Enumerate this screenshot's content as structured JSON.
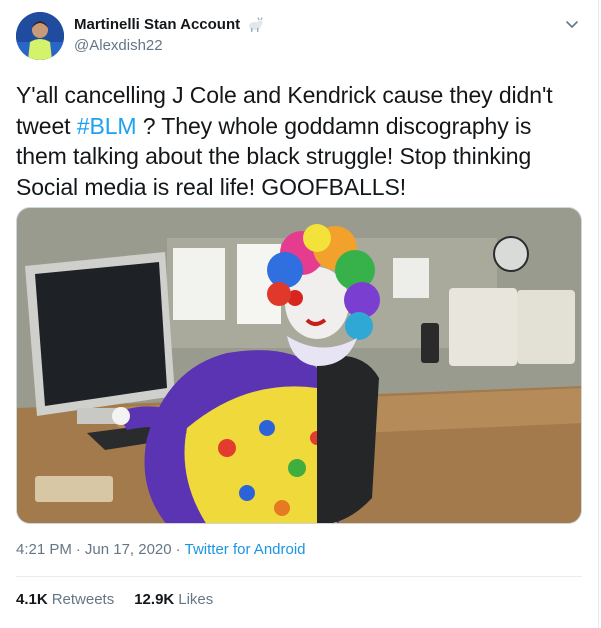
{
  "tweet": {
    "display_name": "Martinelli Stan Account",
    "badge_icon": "goat-emoji-icon",
    "handle": "@Alexdish22",
    "text_before": "Y'all cancelling J Cole and Kendrick cause they didn't tweet ",
    "hashtag": "#BLM",
    "text_after": " ? They whole goddamn discography is them talking about the black struggle! Stop thinking Social media is real life! GOOFBALLS!",
    "time": "4:21 PM",
    "separator1": "·",
    "date": "Jun 17, 2020",
    "separator2": "·",
    "source": "Twitter for Android",
    "retweets_count": "4.1K",
    "retweets_label": "Retweets",
    "likes_count": "12.9K",
    "likes_label": "Likes"
  },
  "colors": {
    "link": "#1da1f2",
    "secondary_text": "#657786",
    "primary_text": "#14171a",
    "divider": "#e6ecf0"
  }
}
